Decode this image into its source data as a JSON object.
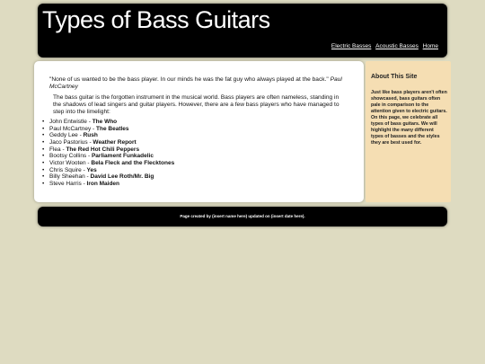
{
  "header": {
    "title": "Types of Bass Guitars",
    "nav": [
      {
        "label": "Electric Basses"
      },
      {
        "label": "Acoustic Basses"
      },
      {
        "label": "Home"
      }
    ]
  },
  "main": {
    "quote": "\"None of us wanted to be the bass player. In our minds he was the fat guy who always played at the back.\"",
    "quote_author": "Paul McCartney",
    "intro": "The bass guitar is the forgotten instrument in the musical world. Bass players are often nameless, standing in the shadows of lead singers and guitar players. However, there are a few bass players who have managed to step into the limelight:",
    "players": [
      {
        "name": "John Entwistle",
        "band": "The Who"
      },
      {
        "name": "Paul McCartney",
        "band": "The Beatles"
      },
      {
        "name": "Geddy Lee",
        "band": "Rush"
      },
      {
        "name": "Jaco Pastorius",
        "band": "Weather Report"
      },
      {
        "name": "Flea",
        "band": "The Red Hot Chili Peppers"
      },
      {
        "name": "Bootsy Collins",
        "band": "Parliament Funkadelic"
      },
      {
        "name": "Victor Wooten",
        "band": "Bela Fleck and the Flecktones"
      },
      {
        "name": "Chris Squire",
        "band": "Yes"
      },
      {
        "name": "Billy Sheehan",
        "band": "David Lee Roth/Mr. Big"
      },
      {
        "name": "Steve Harris",
        "band": "Iron Maiden"
      }
    ]
  },
  "sidebar": {
    "heading": "About This Site",
    "text": "Just like bass players aren't often showcased, bass guitars often pale in comparison to the attention given to electric guitars. On this page, we celebrate all types of bass guitars. We will highlight the many different types of basses and the styles they are best used for."
  },
  "footer": {
    "text": "Page created by (insert name here) updated on (insert date here)."
  }
}
